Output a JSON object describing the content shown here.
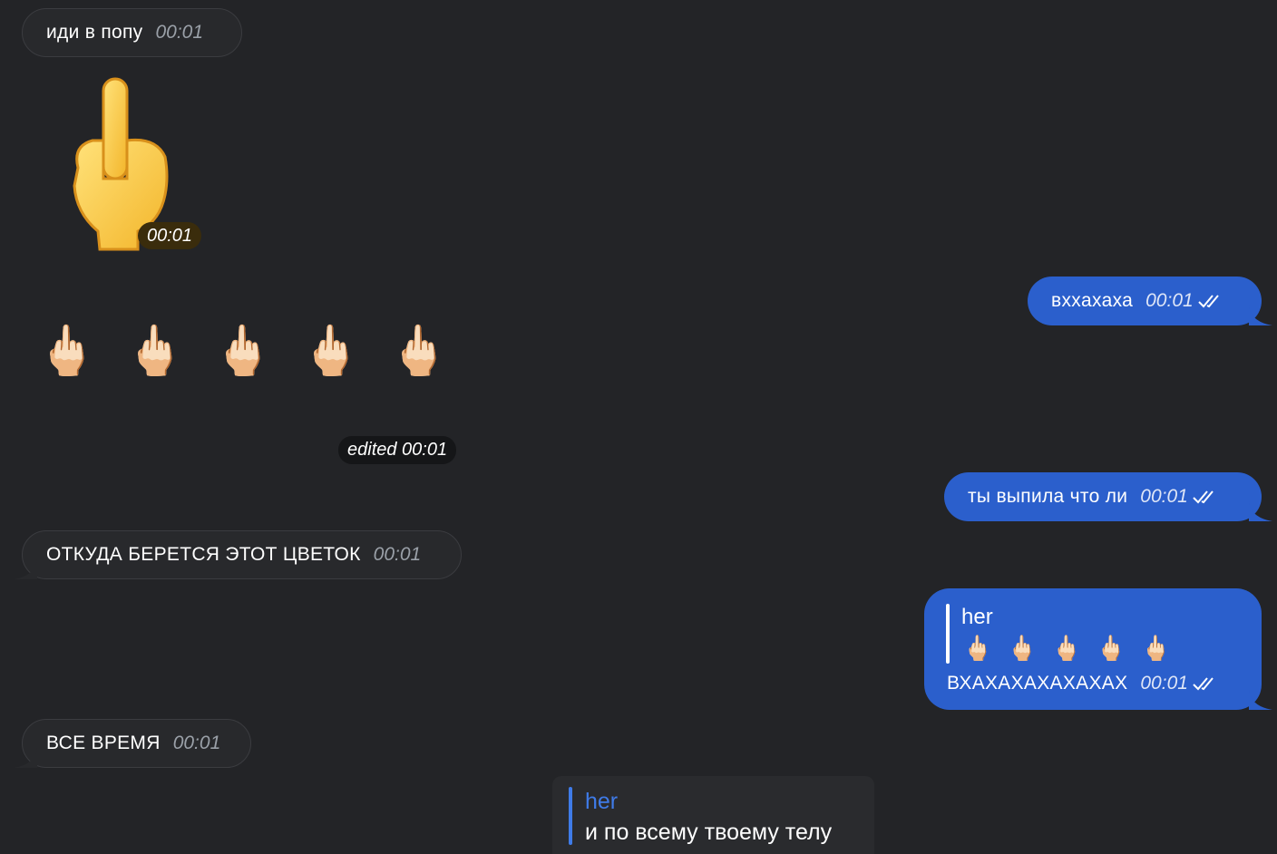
{
  "messages": {
    "m1": {
      "text": "иди в попу",
      "time": "00:01"
    },
    "m2": {
      "sticker": "middle-finger-emoji",
      "time": "00:01"
    },
    "m3": {
      "text": "вхxахаха",
      "time": "00:01"
    },
    "m4": {
      "emoji": [
        "🖕🏻",
        "🖕🏻",
        "🖕🏻",
        "🖕🏻",
        "🖕🏻"
      ],
      "meta": "edited 00:01"
    },
    "m5": {
      "text": "ты выпила что ли",
      "time": "00:01"
    },
    "m6": {
      "text": "ОТКУДА БЕРЕТСЯ ЭТОТ ЦВЕТОК",
      "time": "00:01"
    },
    "m7": {
      "reply_author": "her",
      "reply_emoji": [
        "🖕🏻",
        "🖕🏻",
        "🖕🏻",
        "🖕🏻",
        "🖕🏻"
      ],
      "text": "ВХАХАХАХАХАХАХ",
      "time": "00:01"
    },
    "m8": {
      "text": "ВСЕ ВРЕМЯ",
      "time": "00:01"
    }
  },
  "reply_preview": {
    "author": "her",
    "text": "и по всему твоему телу"
  },
  "colors": {
    "background": "#232427",
    "incoming": "#28292c",
    "outgoing": "#2b5fcc",
    "reply_author": "#3f7be8"
  },
  "icons": {
    "read_receipt": "double-check-icon"
  }
}
